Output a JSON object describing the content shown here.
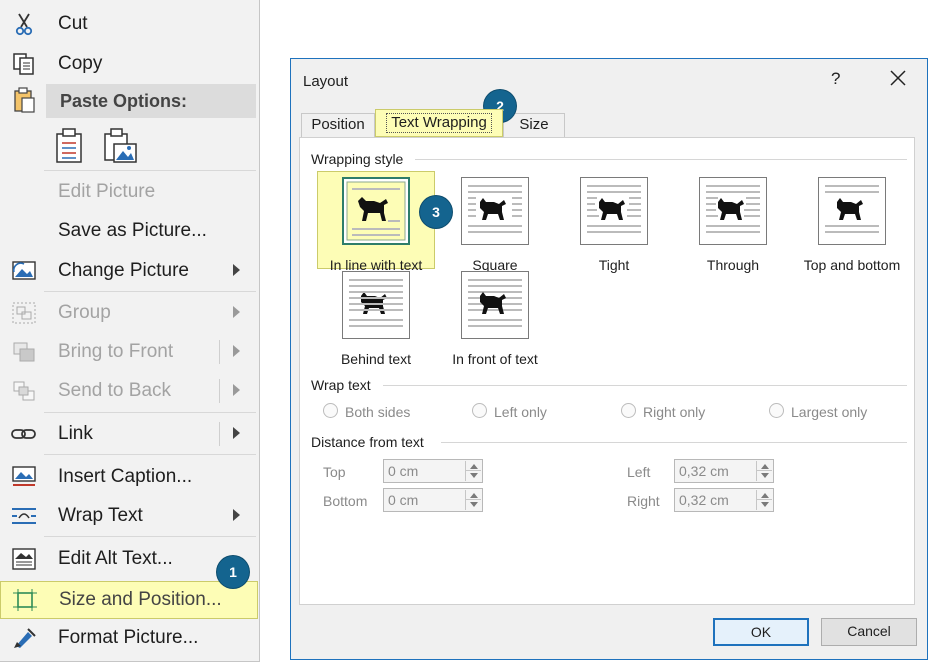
{
  "context_menu": {
    "cut": "Cut",
    "copy": "Copy",
    "paste_options": "Paste Options:",
    "edit_picture": "Edit Picture",
    "save_as_picture": "Save as Picture...",
    "change_picture": "Change Picture",
    "group": "Group",
    "bring_to_front": "Bring to Front",
    "send_to_back": "Send to Back",
    "link": "Link",
    "insert_caption": "Insert Caption...",
    "wrap_text": "Wrap Text",
    "edit_alt_text": "Edit Alt Text...",
    "size_and_position": "Size and Position...",
    "format_picture": "Format Picture...",
    "badge": "1"
  },
  "dialog": {
    "title": "Layout",
    "help": "?",
    "tabs": [
      "Position",
      "Text Wrapping",
      "Size"
    ],
    "active_tab": "Text Wrapping",
    "tab_badge": "2",
    "wrapping_style": {
      "heading": "Wrapping style",
      "options": [
        "In line with text",
        "Square",
        "Tight",
        "Through",
        "Top and bottom",
        "Behind text",
        "In front of text"
      ],
      "selected": "In line with text",
      "badge": "3"
    },
    "wrap_text": {
      "heading": "Wrap text",
      "options": [
        "Both sides",
        "Left only",
        "Right only",
        "Largest only"
      ]
    },
    "distance": {
      "heading": "Distance from text",
      "top_label": "Top",
      "top_value": "0 cm",
      "bottom_label": "Bottom",
      "bottom_value": "0 cm",
      "left_label": "Left",
      "left_value": "0,32 cm",
      "right_label": "Right",
      "right_value": "0,32 cm"
    },
    "ok": "OK",
    "cancel": "Cancel"
  },
  "colors": {
    "highlight": "#fdfdb6",
    "badge": "#14648f",
    "dialog_border": "#1e72bd"
  }
}
